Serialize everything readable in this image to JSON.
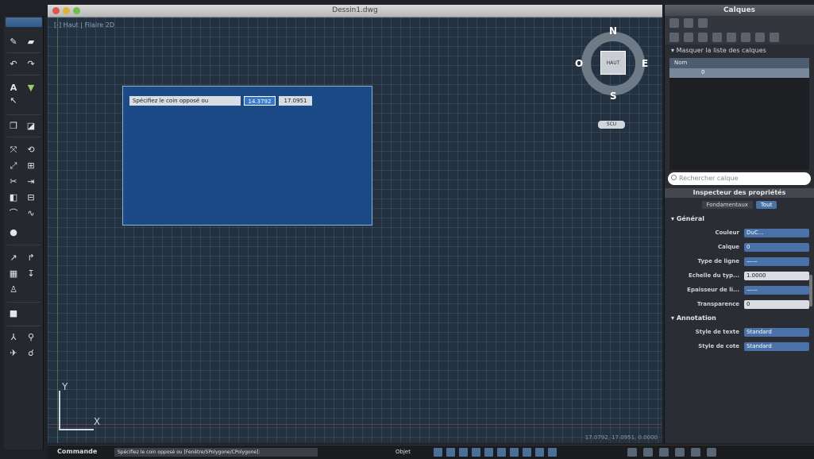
{
  "window": {
    "title": "Dessin1.dwg"
  },
  "toolbar": {
    "icons": [
      "line-icon",
      "polyline-icon",
      "undo-icon",
      "redo-icon",
      "text-icon",
      "hatch-icon",
      "pointer-icon",
      "copy-icon",
      "mirror-icon",
      "move-icon",
      "rotate-icon",
      "scale-icon",
      "stretch-icon",
      "trim-icon",
      "extend-icon",
      "fillet-icon",
      "array-icon",
      "circle-icon",
      "arc-icon",
      "spline-icon",
      "dimension-icon",
      "leader-icon",
      "table-icon",
      "user-icon",
      "measure-icon",
      "pan-icon",
      "zoom-icon"
    ]
  },
  "canvas": {
    "view_label": "[-] Haut | Filaire 2D",
    "axis_x": "X",
    "axis_y": "Y",
    "prompt_label": "Spécifiez le coin opposé ou",
    "coord_x": "14.3792",
    "coord_y": "17.0951",
    "viewcube": {
      "north": "N",
      "south": "S",
      "east": "E",
      "west": "O",
      "face": "HAUT"
    },
    "wcs": "SCU",
    "coordinates": "17.0792, 17.0951, 0.0000"
  },
  "layers_panel": {
    "title": "Calques",
    "toggle_label": "Masquer la liste des calques",
    "column_name": "Nom",
    "first_layer": "0",
    "search_placeholder": "Rechercher calque"
  },
  "inspector": {
    "title": "Inspecteur des propriétés",
    "tab_basic": "Fondamentaux",
    "tab_all": "Tout",
    "section_general": "Général",
    "section_annotation": "Annotation",
    "props": [
      {
        "key": "Couleur",
        "value": "DuC..."
      },
      {
        "key": "Calque",
        "value": "0"
      },
      {
        "key": "Type de ligne",
        "value": "——"
      },
      {
        "key": "Echelle du typ...",
        "value": "1.0000"
      },
      {
        "key": "Epaisseur de li...",
        "value": "——"
      },
      {
        "key": "Transparence",
        "value": "0"
      }
    ],
    "annotation_props": [
      {
        "key": "Style de texte",
        "value": "Standard"
      },
      {
        "key": "Style de cote",
        "value": "Standard"
      }
    ]
  },
  "bottombar": {
    "command_label": "Commande",
    "command_text": "Spécifiez le coin opposé ou [Fenêtre/SPolygone/CPolygone]:",
    "objet_label": "Objet"
  },
  "colors": {
    "canvas": "#243141",
    "selection": "#1c4a86",
    "accent": "#4a72a8"
  }
}
